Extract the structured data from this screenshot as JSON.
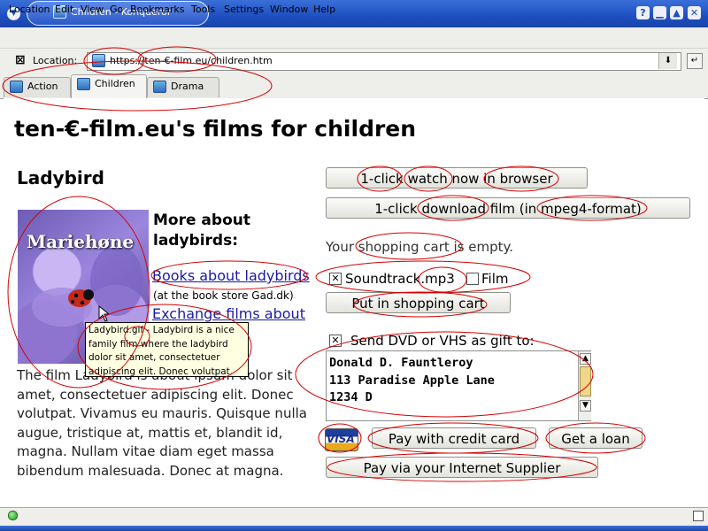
{
  "window": {
    "title": "Children - Konqueror"
  },
  "menubar": {
    "items": [
      "Location",
      "Edit",
      "View",
      "Go",
      "Bookmarks",
      "Tools",
      "Settings",
      "Window",
      "Help"
    ]
  },
  "locationbar": {
    "label": "Location:",
    "url": "https://ten-€-film.eu/children.htm"
  },
  "tabs": [
    {
      "label": "Action",
      "active": false
    },
    {
      "label": "Children",
      "active": true
    },
    {
      "label": "Drama",
      "active": false
    }
  ],
  "page": {
    "heading": "ten-€-film.eu's films for children",
    "film_title": "Ladybird",
    "photo_caption": "Mariehøne",
    "more_about": "More about ladybirds:",
    "links": {
      "books": "Books about ladybirds",
      "exchange": "Exchange films about"
    },
    "store_note": "(at the book store Gad.dk)",
    "description": "The film Ladybird is about ipsum dolor sit amet, consectetuer adipiscing elit. Donec volutpat. Vivamus eu mauris. Quisque nulla augue, tristique at, mattis et, blandit id, magna. Nullam vitae diam eget massa bibendum malesuada. Donec at magna.",
    "tooltip": "Ladybird.gif - Ladybird is a nice family film where the ladybird dolor sit amet, consectetuer adipiscing elit. Donec volutpat."
  },
  "actions": {
    "watch_button": "1-click watch now in browser",
    "download_button": "1-click download film (in mpeg4-format)",
    "cart_status": "Your shopping cart is empty.",
    "soundtrack_checkbox": {
      "label": "Soundtrack.mp3",
      "checked": true
    },
    "film_checkbox": {
      "label": "Film",
      "checked": false
    },
    "put_in_cart_button": "Put in shopping cart",
    "gift_checkbox": {
      "label": "Send DVD or VHS as gift to:",
      "checked": true
    },
    "address": "Donald D. Fauntleroy\n113 Paradise Apple Lane\n1234 D",
    "visa_label": "VISA",
    "pay_card_button": "Pay with credit card",
    "loan_button": "Get a loan",
    "pay_isp_button": "Pay via your Internet Supplier"
  },
  "colors": {
    "titlebar": "#1d4fc0",
    "link": "#1a1aa6",
    "annotation": "#d40000",
    "tooltip_bg": "#ffffe1"
  }
}
